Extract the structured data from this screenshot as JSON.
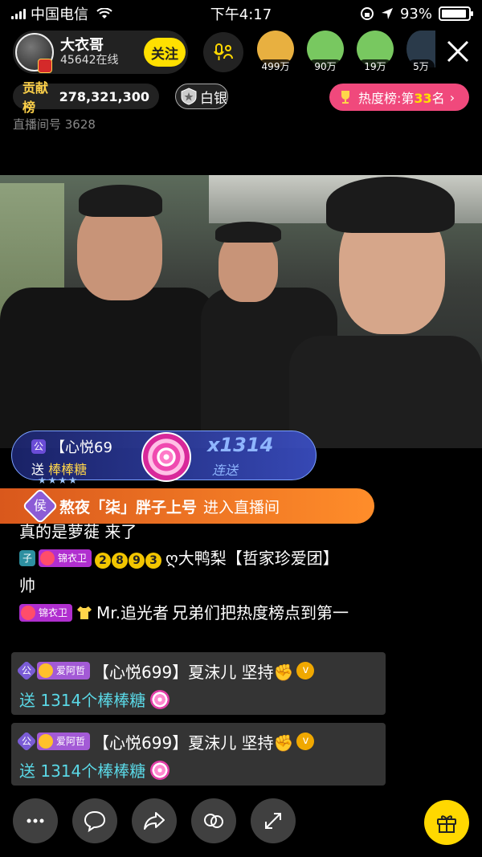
{
  "status_bar": {
    "carrier": "中国电信",
    "time": "下午4:17",
    "battery": "93%",
    "battery_level": 0.93
  },
  "host": {
    "name": "大衣哥",
    "online": "45642在线",
    "follow_label": "关注"
  },
  "top_viewers": [
    {
      "count": "499万",
      "color": "#e8b040"
    },
    {
      "count": "90万",
      "color": "#78c860"
    },
    {
      "count": "19万",
      "color": "#78c860"
    },
    {
      "count": "5万",
      "color": "#2a3a4a"
    }
  ],
  "contribution": {
    "label": "贡献榜",
    "value": "278,321,300"
  },
  "level_badge": "白银",
  "hot_rank": {
    "prefix": "热度榜:第",
    "rank": "33",
    "suffix": "名",
    "arrow": "›"
  },
  "room_no": "直播间号 3628",
  "gift_banner": {
    "level": "公",
    "user": "【心悦69",
    "send": "送",
    "gift": "棒棒糖",
    "combo": "x1314",
    "combo_label": "连送"
  },
  "entrance": {
    "badge": "侯",
    "name": "熬夜「柒」胖子上号",
    "text": "进入直播间"
  },
  "chat_cut": "真的是萝蓰 来了",
  "chat": [
    {
      "badge": "子",
      "guard": "锦衣卫",
      "nums": [
        "2",
        "8",
        "9",
        "3"
      ],
      "name": "ღ大鸭梨【哲家珍爱团】",
      "msg": "帅"
    },
    {
      "guard": "锦衣卫",
      "name": "Mr.追光者",
      "msg": "兄弟们把热度榜点到第一"
    }
  ],
  "gift_messages": [
    {
      "level": "公",
      "fan": "爱阿哲",
      "user": "【心悦699】夏沫儿 坚持✊",
      "v": "v",
      "text": "送 1314个棒棒糖"
    },
    {
      "level": "公",
      "fan": "爱阿哲",
      "user": "【心悦699】夏沫儿 坚持✊",
      "v": "v",
      "text": "送 1314个棒棒糖"
    }
  ],
  "icons": {
    "more": "more-icon",
    "chat": "chat-bubble-icon",
    "share": "share-icon",
    "link": "link-icon",
    "fullscreen": "expand-icon",
    "gift": "gift-icon",
    "close": "close-icon",
    "mic": "mic-link-icon"
  }
}
